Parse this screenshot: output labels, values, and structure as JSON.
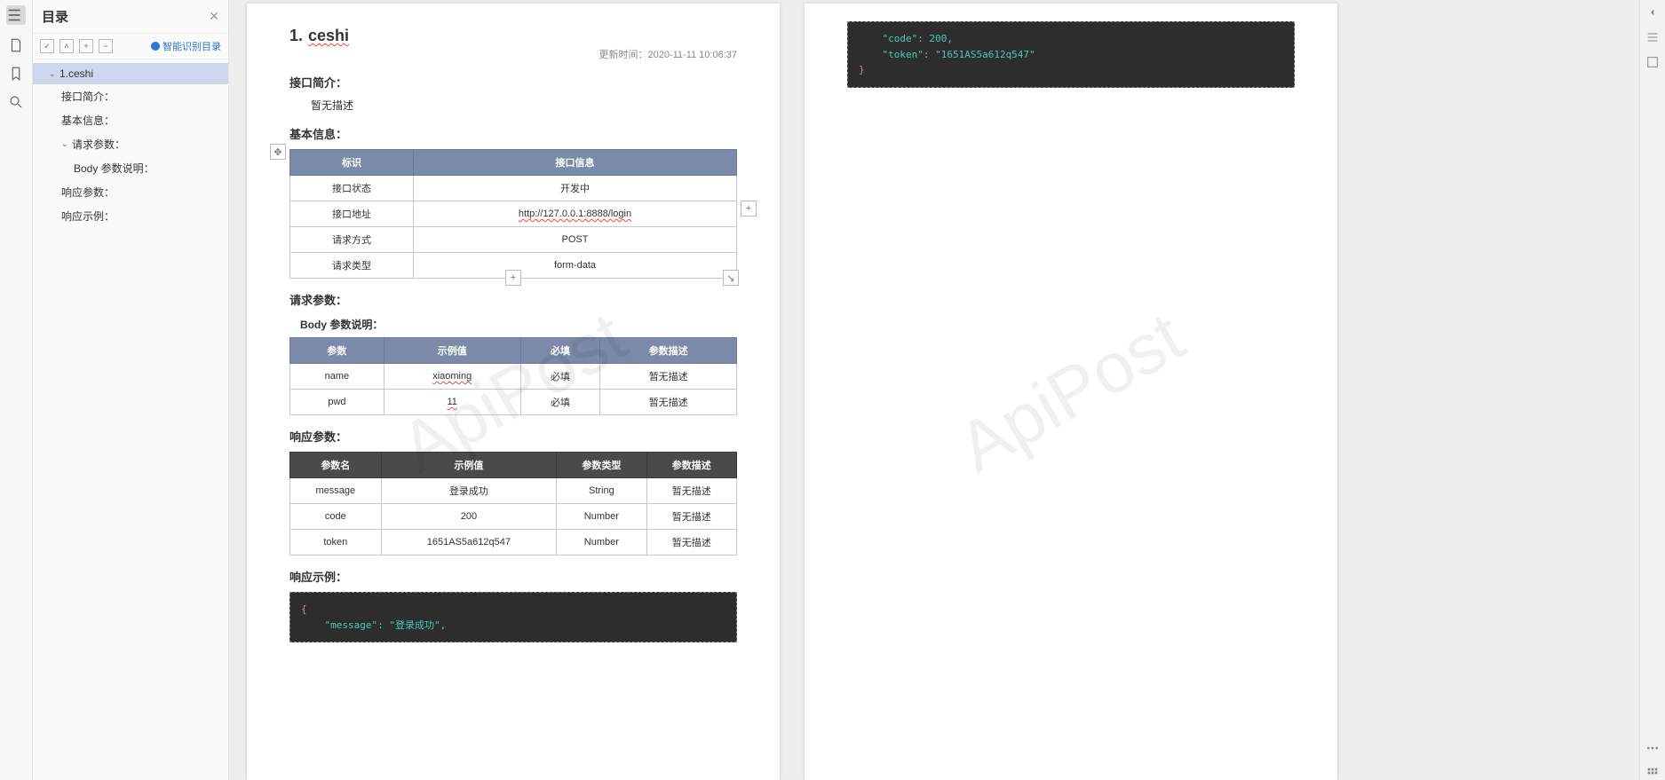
{
  "sidebar": {
    "title": "目录",
    "smart_link": "智能识别目录",
    "tool_icons": [
      "check-icon",
      "up-icon",
      "plus-icon",
      "minus-icon"
    ],
    "tree": [
      {
        "label": "1.ceshi",
        "depth": 0,
        "selected": true,
        "expand": "open"
      },
      {
        "label": "接口简介：",
        "depth": 1
      },
      {
        "label": "基本信息：",
        "depth": 1
      },
      {
        "label": "请求参数：",
        "depth": 1,
        "expand": "open"
      },
      {
        "label": "Body 参数说明：",
        "depth": 2
      },
      {
        "label": "响应参数：",
        "depth": 1
      },
      {
        "label": "响应示例：",
        "depth": 1
      }
    ]
  },
  "watermark": "ApiPost",
  "doc": {
    "title_num": "1.",
    "title_text": "ceshi",
    "updated_label": "更新时间：",
    "updated_value": "2020-11-11 10:06:37",
    "s_intro": "接口简介：",
    "intro_text": "暂无描述",
    "s_basic": "基本信息：",
    "basic_headers": [
      "标识",
      "接口信息"
    ],
    "basic_rows": [
      [
        "接口状态",
        "开发中"
      ],
      [
        "接口地址",
        "http://127.0.0.1:8888/login"
      ],
      [
        "请求方式",
        "POST"
      ],
      [
        "请求类型",
        "form-data"
      ]
    ],
    "s_req": "请求参数：",
    "s_body": "Body 参数说明：",
    "req_headers": [
      "参数",
      "示例值",
      "必填",
      "参数描述"
    ],
    "req_rows": [
      [
        "name",
        "xiaoming",
        "必填",
        "暂无描述"
      ],
      [
        "pwd",
        "11",
        "必填",
        "暂无描述"
      ]
    ],
    "s_resp": "响应参数：",
    "resp_headers": [
      "参数名",
      "示例值",
      "参数类型",
      "参数描述"
    ],
    "resp_rows": [
      [
        "message",
        "登录成功",
        "String",
        "暂无描述"
      ],
      [
        "code",
        "200",
        "Number",
        "暂无描述"
      ],
      [
        "token",
        "1651AS5a612q547",
        "Number",
        "暂无描述"
      ]
    ],
    "s_example": "响应示例：",
    "code_page1_lines": [
      {
        "t": "{",
        "cls": "br"
      },
      {
        "t": "    \"message\": \"登录成功\",",
        "cls": "str"
      }
    ],
    "code_page2_lines": [
      {
        "t": "    \"code\": 200,",
        "cls": "num"
      },
      {
        "t": "    \"token\": \"1651AS5a612q547\"",
        "cls": "str"
      },
      {
        "t": "}",
        "cls": "br"
      }
    ]
  }
}
